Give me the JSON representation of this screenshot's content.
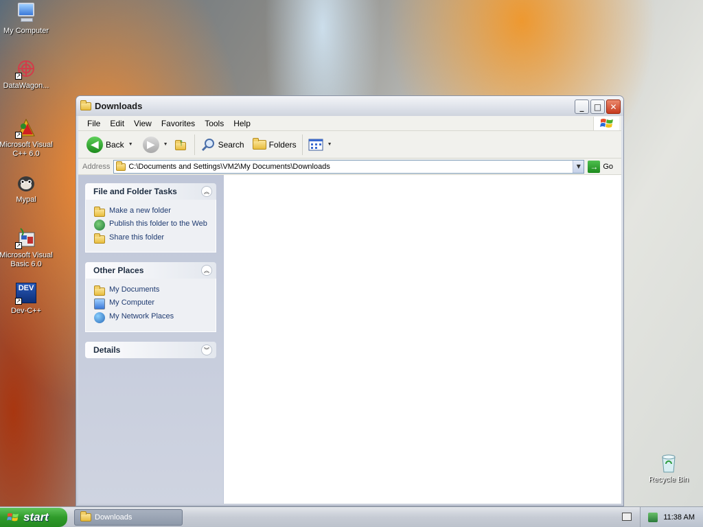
{
  "desktop": {
    "icons": [
      {
        "label": "My Computer"
      },
      {
        "label": "DataWagon..."
      },
      {
        "label": "Microsoft Visual C++ 6.0"
      },
      {
        "label": "Mypal"
      },
      {
        "label": "Microsoft Visual Basic 6.0"
      },
      {
        "label": "Dev-C++"
      },
      {
        "label": "Recycle Bin"
      }
    ],
    "dev_icon_text": "DEV"
  },
  "window": {
    "title": "Downloads",
    "menu": [
      "File",
      "Edit",
      "View",
      "Favorites",
      "Tools",
      "Help"
    ],
    "toolbar": {
      "back": "Back",
      "search": "Search",
      "folders": "Folders"
    },
    "address": {
      "label": "Address",
      "value": "C:\\Documents and Settings\\VM2\\My Documents\\Downloads",
      "go": "Go"
    },
    "taskpane": {
      "file_tasks": {
        "title": "File and Folder Tasks",
        "items": [
          "Make a new folder",
          "Publish this folder to the Web",
          "Share this folder"
        ]
      },
      "other_places": {
        "title": "Other Places",
        "items": [
          "My Documents",
          "My Computer",
          "My Network Places"
        ]
      },
      "details": {
        "title": "Details"
      }
    }
  },
  "taskbar": {
    "start": "start",
    "task": "Downloads",
    "clock": "11:38 AM"
  }
}
